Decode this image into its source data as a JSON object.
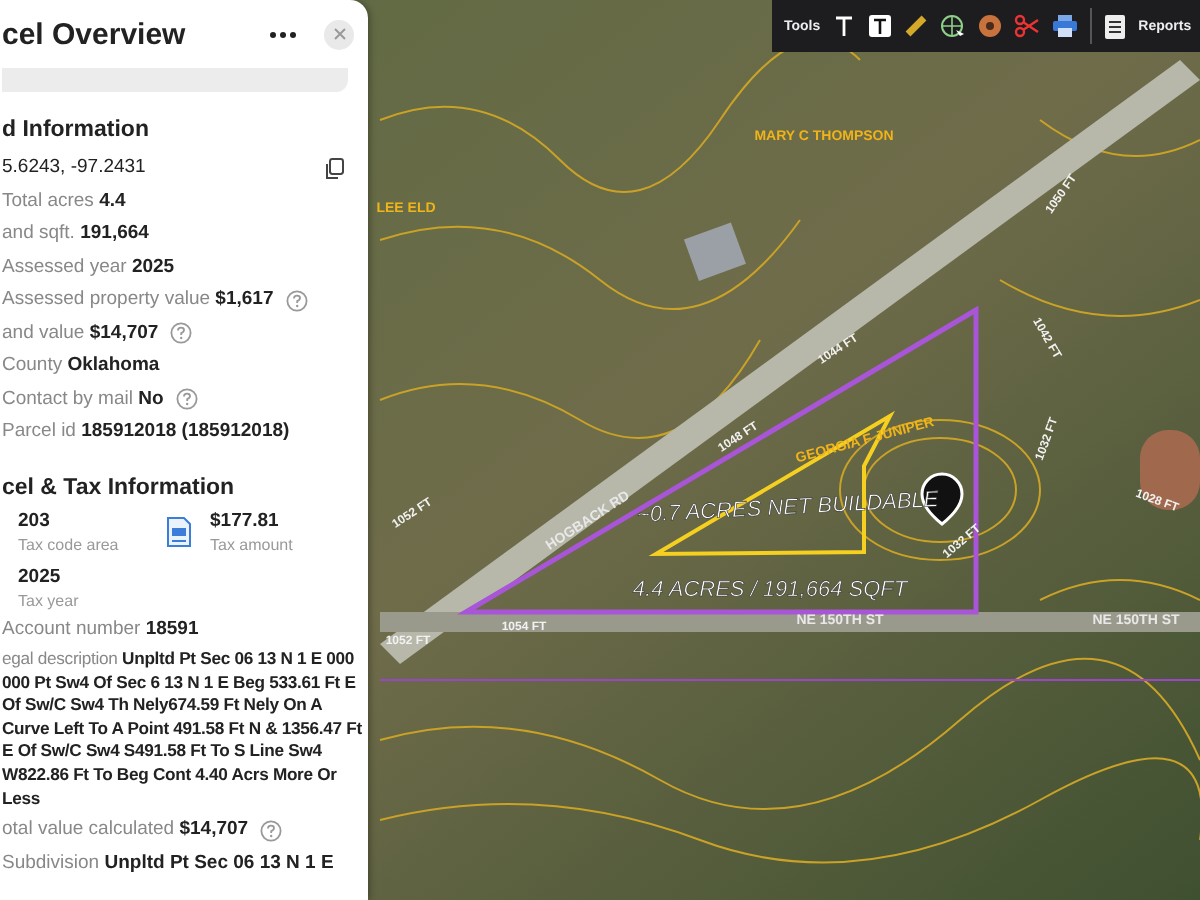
{
  "toolbar": {
    "tools_label": "Tools",
    "reports_label": "Reports"
  },
  "panel": {
    "title": "cel Overview",
    "land": {
      "heading": "d Information",
      "coordinates": "5.6243, -97.2431",
      "fields": [
        {
          "label": "Total acres",
          "value": "4.4",
          "help": false
        },
        {
          "label": "and sqft.",
          "value": "191,664",
          "help": false
        },
        {
          "label": "Assessed year",
          "value": "2025",
          "help": false
        },
        {
          "label": "Assessed property value",
          "value": "$1,617",
          "help": true
        },
        {
          "label": "and value",
          "value": "$14,707",
          "help": true
        },
        {
          "label": "County",
          "value": "Oklahoma",
          "help": false
        },
        {
          "label": "Contact by mail",
          "value": "No",
          "help": true
        },
        {
          "label": "Parcel id",
          "value": "185912018 (185912018)",
          "help": false
        }
      ]
    },
    "tax": {
      "heading": "cel & Tax Information",
      "stats": [
        {
          "value": "203",
          "label": "Tax code area"
        },
        {
          "value": "$177.81",
          "label": "Tax amount"
        },
        {
          "value": "2025",
          "label": "Tax year"
        }
      ],
      "fields": [
        {
          "label": "Account number",
          "value": "18591",
          "help": false
        },
        {
          "label": "egal description",
          "value": "Unpltd Pt Sec 06 13 N 1 E 000 000 Pt Sw4 Of Sec 6 13 N 1 E Beg 533.61 Ft E Of Sw/C Sw4 Th Nely674.59 Ft Nely On A Curve Left To A Point 491.58 Ft N & 1356.47 Ft E Of Sw/C Sw4 S491.58 Ft To S Line Sw4 W822.86 Ft To Beg Cont 4.40 Acrs More Or Less",
          "help": false
        },
        {
          "label": "otal value calculated",
          "value": "$14,707",
          "help": true
        },
        {
          "label": "Subdivision",
          "value": "Unpltd Pt Sec 06 13 N 1 E",
          "help": false
        }
      ]
    }
  },
  "map": {
    "labels": [
      {
        "kind": "owner",
        "text": "MARY C THOMPSON"
      },
      {
        "kind": "owner",
        "text": "LEE ELD"
      },
      {
        "kind": "owner",
        "text": "GEORGIA F JUNIPER"
      },
      {
        "kind": "road",
        "text": "HOGBACK RD"
      },
      {
        "kind": "road",
        "text": "NE 150TH ST"
      },
      {
        "kind": "road",
        "text": "NE 150TH ST"
      },
      {
        "kind": "area",
        "text": "~0.7 ACRES NET BUILDABLE"
      },
      {
        "kind": "area",
        "text": "4.4 ACRES / 191,664 SQFT"
      },
      {
        "kind": "contour",
        "text": "1044 FT"
      },
      {
        "kind": "contour",
        "text": "1048 FT"
      },
      {
        "kind": "contour",
        "text": "1052 FT"
      },
      {
        "kind": "contour",
        "text": "1052 FT"
      },
      {
        "kind": "contour",
        "text": "1054 FT"
      },
      {
        "kind": "contour",
        "text": "1032 FT"
      },
      {
        "kind": "contour",
        "text": "1050 FT"
      },
      {
        "kind": "contour",
        "text": "1042 FT"
      },
      {
        "kind": "contour",
        "text": "1032 FT"
      },
      {
        "kind": "contour",
        "text": "1028 FT"
      }
    ]
  }
}
